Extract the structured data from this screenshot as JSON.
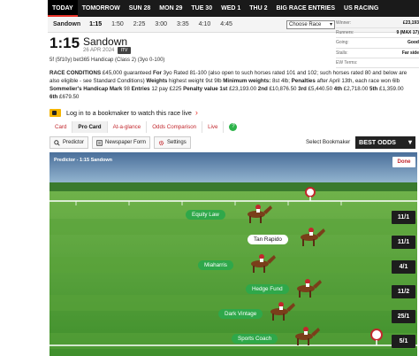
{
  "nav": {
    "days": [
      "TODAY",
      "TOMORROW",
      "SUN 28",
      "MON 29",
      "TUE 30",
      "WED 1",
      "THU 2",
      "BIG RACE ENTRIES",
      "US RACING"
    ]
  },
  "timebar": {
    "venue": "Sandown",
    "times": [
      "1:15",
      "1:50",
      "2:25",
      "3:00",
      "3:35",
      "4:10",
      "4:45"
    ],
    "choose_label": "Choose Race"
  },
  "race": {
    "time": "1:15",
    "venue": "Sandown",
    "date": "26 APR 2024",
    "tv_label": "ITV",
    "class_line": "5f (5f10y) bet365 Handicap (Class 2) (3yo 0-100)"
  },
  "info": [
    {
      "k": "Winner:",
      "v": "£23,193"
    },
    {
      "k": "Runners:",
      "v": "9 (MAX 17)"
    },
    {
      "k": "Going:",
      "v": "Good"
    },
    {
      "k": "Stalls:",
      "v": "Far side"
    },
    {
      "k": "EW Terms:",
      "v": ""
    }
  ],
  "conditions": {
    "l1_a": "RACE CONDITIONS",
    "l1_b": " £45,000 guaranteed ",
    "l1_c": "For",
    "l1_d": " 3yo Rated 81-100 (also open to such horses rated 101 and 102; such horses rated 80 and below are",
    "l2_a": "also eligible - see Standard Conditions) ",
    "l2_b": "Weights",
    "l2_c": " highest weight 9st 9lb ",
    "l2_d": "Minimum weights:",
    "l2_e": " 8st 4lb; ",
    "l2_f": "Penalties",
    "l2_g": " after April 13th, each race won 6lb",
    "l3_a": "Sommelier's Handicap Mark",
    "l3_b": " 98 ",
    "l3_c": "Entries",
    "l3_d": " 12 pay £225 ",
    "l3_e": "Penalty value",
    "l3_f": " 1st",
    "l3_g": " £23,193.00 ",
    "l3_h": "2nd",
    "l3_i": " £10,876.50 ",
    "l3_j": "3rd",
    "l3_k": " £5,440.50 ",
    "l3_l": "4th",
    "l3_m": " £2,718.00 ",
    "l3_n": "5th",
    "l3_o": " £1,359.00",
    "l4_a": "6th",
    "l4_b": " £679.50"
  },
  "bookmaker_login": "Log in to a bookmaker to watch this race live",
  "tabs": [
    "Card",
    "Pro Card",
    "At-a-glance",
    "Odds Comparison",
    "Live"
  ],
  "help_icon": "?",
  "toolbar": {
    "predictor": "Predictor",
    "newspaper": "Newspaper Form",
    "settings": "Settings",
    "select_label": "Select Bookmaker",
    "select_value": "BEST ODDS"
  },
  "predictor": {
    "title": "Predictor - 1:15 Sandown",
    "done": "Done",
    "horses": [
      {
        "name": "Equity Law",
        "odds": "11/1",
        "style": "green"
      },
      {
        "name": "Tan Rapido",
        "odds": "11/1",
        "style": "white"
      },
      {
        "name": "Miaharris",
        "odds": "4/1",
        "style": "green"
      },
      {
        "name": "Hedge Fund",
        "odds": "11/2",
        "style": "green"
      },
      {
        "name": "Dark Vintage",
        "odds": "25/1",
        "style": "green"
      },
      {
        "name": "Sports Coach",
        "odds": "5/1",
        "style": "green"
      }
    ]
  },
  "colors": {
    "accent_red": "#e8332a",
    "turf_green": "#5aa33a",
    "label_green": "#2fa84a",
    "nav_black": "#1a1a1a"
  }
}
